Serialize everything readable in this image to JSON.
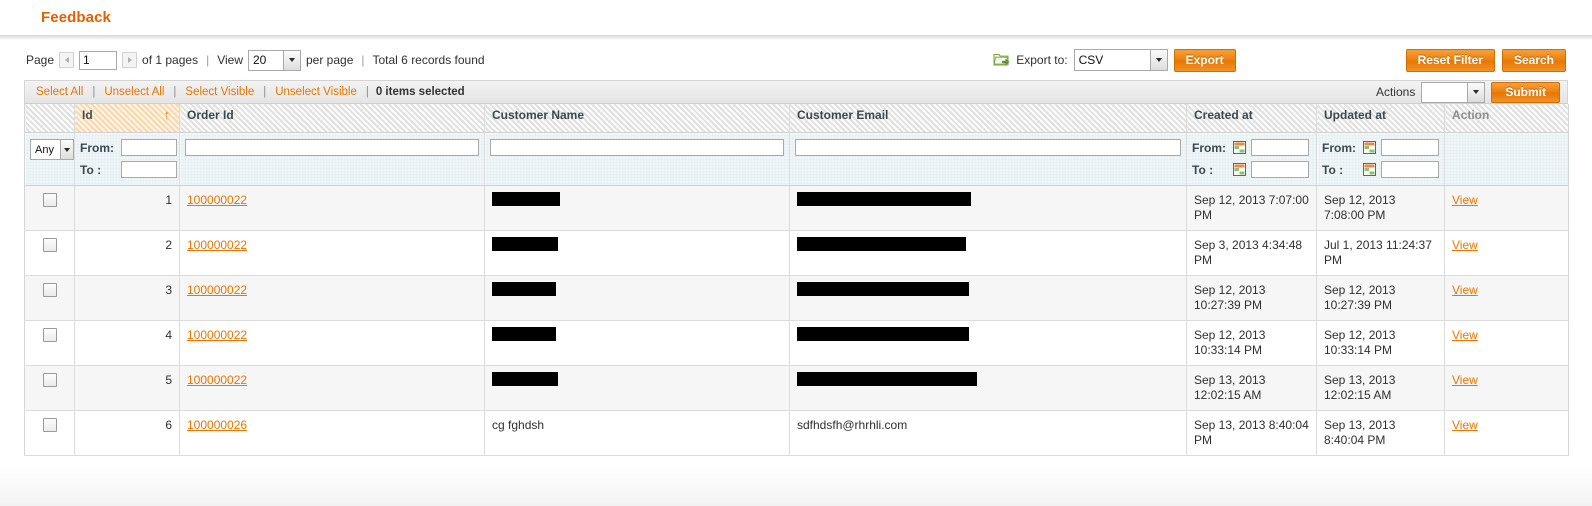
{
  "header": {
    "title": "Feedback"
  },
  "toolbar": {
    "page_label": "Page",
    "page_value": "1",
    "of_pages": "of 1 pages",
    "view_label": "View",
    "view_value": "20",
    "per_page": "per page",
    "total_records": "Total 6 records found",
    "export_to_label": "Export to:",
    "export_format": "CSV",
    "export_button": "Export",
    "reset_filter_button": "Reset Filter",
    "search_button": "Search",
    "export_icon": "export-folder-icon",
    "prev_page_icon": "left-triangle-icon",
    "next_page_icon": "right-triangle-icon"
  },
  "massaction": {
    "select_all": "Select All",
    "unselect_all": "Unselect All",
    "select_visible": "Select Visible",
    "unselect_visible": "Unselect Visible",
    "items_selected": "0 items selected",
    "actions_label": "Actions",
    "actions_value": "",
    "submit_button": "Submit",
    "separator": "|"
  },
  "grid": {
    "columns": [
      {
        "key": "checkbox",
        "label": ""
      },
      {
        "key": "id",
        "label": "Id",
        "sorted": true,
        "sort_dir": "asc"
      },
      {
        "key": "order_id",
        "label": "Order Id"
      },
      {
        "key": "customer_name",
        "label": "Customer Name"
      },
      {
        "key": "customer_email",
        "label": "Customer Email"
      },
      {
        "key": "created_at",
        "label": "Created at"
      },
      {
        "key": "updated_at",
        "label": "Updated at"
      },
      {
        "key": "action",
        "label": "Action"
      }
    ],
    "filters": {
      "any_select": "Any",
      "from_label": "From:",
      "to_label": "To :",
      "id_from": "",
      "id_to": "",
      "order_id": "",
      "customer_name": "",
      "customer_email": "",
      "created_from": "",
      "created_to": "",
      "updated_from": "",
      "updated_to": "",
      "calendar_icon": "calendar-icon"
    },
    "rows": [
      {
        "id": "1",
        "order_id": "100000022",
        "customer_name": "",
        "customer_email": "",
        "name_redacted": true,
        "email_redacted": true,
        "name_bar_width": 68,
        "email_bar_width": 174,
        "created_at": "Sep 12, 2013 7:07:00 PM",
        "updated_at": "Sep 12, 2013 7:08:00 PM",
        "action": "View"
      },
      {
        "id": "2",
        "order_id": "100000022",
        "customer_name": "",
        "customer_email": "",
        "name_redacted": true,
        "email_redacted": true,
        "name_bar_width": 66,
        "email_bar_width": 169,
        "created_at": "Sep 3, 2013 4:34:48 PM",
        "updated_at": "Jul 1, 2013 11:24:37 PM",
        "action": "View"
      },
      {
        "id": "3",
        "order_id": "100000022",
        "customer_name": "",
        "customer_email": "",
        "name_redacted": true,
        "email_redacted": true,
        "name_bar_width": 64,
        "email_bar_width": 172,
        "created_at": "Sep 12, 2013 10:27:39 PM",
        "updated_at": "Sep 12, 2013 10:27:39 PM",
        "action": "View"
      },
      {
        "id": "4",
        "order_id": "100000022",
        "customer_name": "",
        "customer_email": "",
        "name_redacted": true,
        "email_redacted": true,
        "name_bar_width": 64,
        "email_bar_width": 172,
        "created_at": "Sep 12, 2013 10:33:14 PM",
        "updated_at": "Sep 12, 2013 10:33:14 PM",
        "action": "View"
      },
      {
        "id": "5",
        "order_id": "100000022",
        "customer_name": "",
        "customer_email": "",
        "name_redacted": true,
        "email_redacted": true,
        "name_bar_width": 66,
        "email_bar_width": 180,
        "created_at": "Sep 13, 2013 12:02:15 AM",
        "updated_at": "Sep 13, 2013 12:02:15 AM",
        "action": "View"
      },
      {
        "id": "6",
        "order_id": "100000026",
        "customer_name": "cg fghdsh",
        "customer_email": "sdfhdsfh@rhrhli.com",
        "name_redacted": false,
        "email_redacted": false,
        "created_at": "Sep 13, 2013 8:40:04 PM",
        "updated_at": "Sep 13, 2013 8:40:04 PM",
        "action": "View"
      }
    ]
  },
  "colors": {
    "accent_orange": "#ea7601",
    "title_orange": "#e06000",
    "header_hatch": "#ebebeb",
    "filter_row_blue": "#e3eef1",
    "sorted_header": "#fbe3c6",
    "row_odd": "#f6f6f6",
    "row_even": "#ffffff"
  }
}
